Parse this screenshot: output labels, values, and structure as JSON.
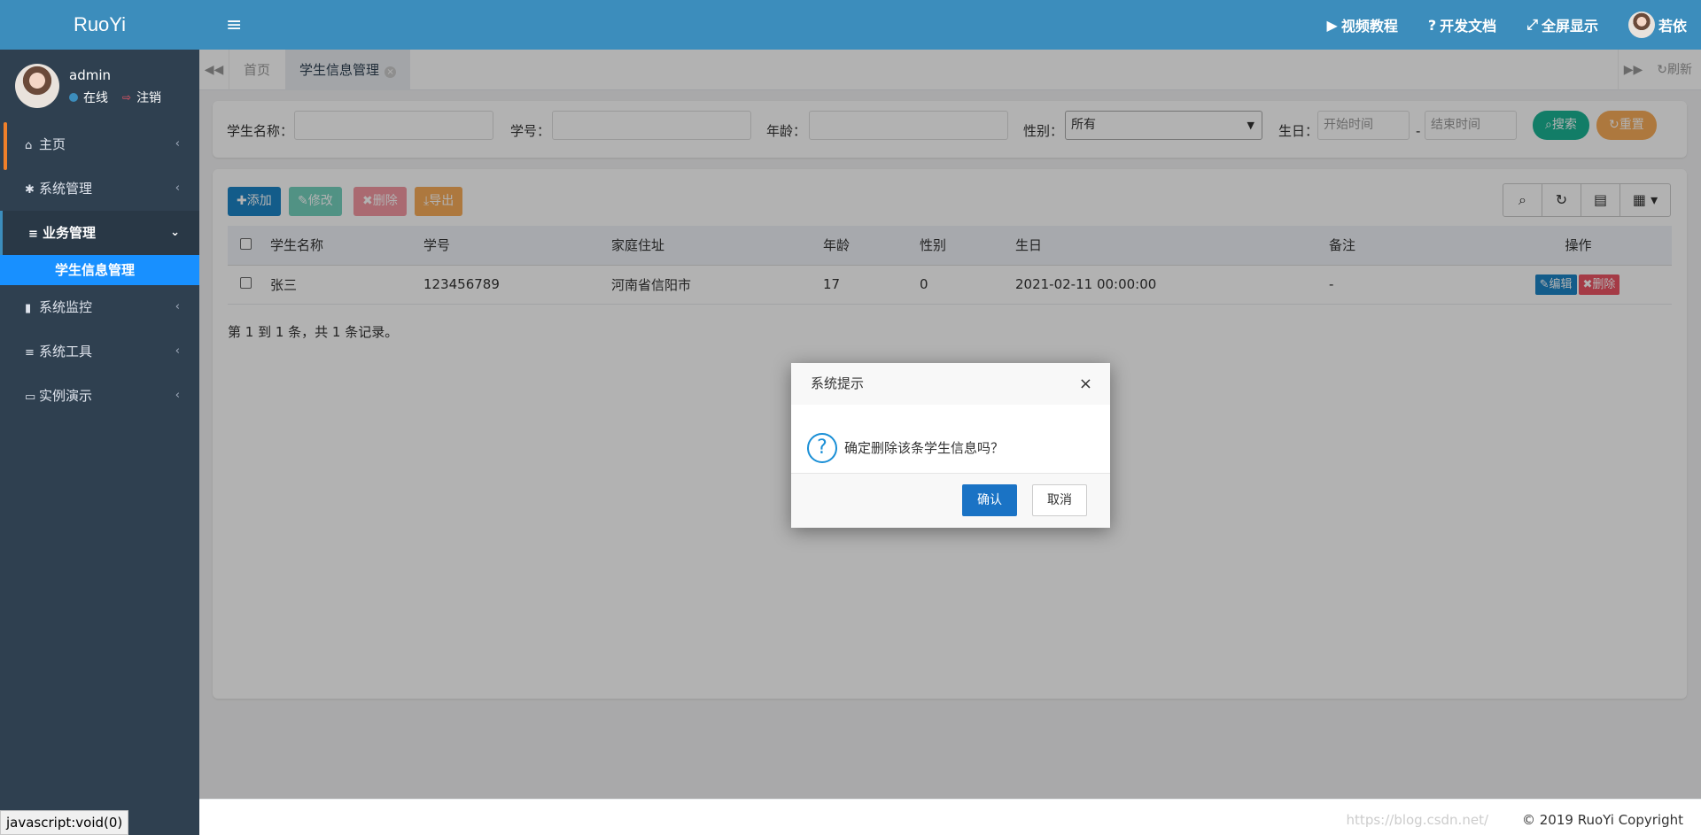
{
  "brand": "RuoYi",
  "user": {
    "name": "admin",
    "status": "在线",
    "logout": "注销"
  },
  "sidebar": {
    "items": [
      {
        "label": "主页",
        "icon": "home-icon",
        "glyph": "⌂"
      },
      {
        "label": "系统管理",
        "icon": "gear-icon",
        "glyph": "✱"
      },
      {
        "label": "业务管理",
        "icon": "bars-icon",
        "glyph": "≡",
        "active": true
      },
      {
        "label": "系统监控",
        "icon": "video-icon",
        "glyph": "▮"
      },
      {
        "label": "系统工具",
        "icon": "bars-icon",
        "glyph": "≡"
      },
      {
        "label": "实例演示",
        "icon": "desktop-icon",
        "glyph": "▭"
      }
    ],
    "sub_item": "学生信息管理"
  },
  "topbar": {
    "video": "视频教程",
    "docs": "开发文档",
    "fullscreen": "全屏显示",
    "user": "若依"
  },
  "tabs": {
    "home": "首页",
    "active": "学生信息管理",
    "refresh": "刷新"
  },
  "search": {
    "name_label": "学生名称：",
    "no_label": "学号：",
    "age_label": "年龄：",
    "gender_label": "性别：",
    "gender_value": "所有",
    "birth_label": "生日：",
    "start_placeholder": "开始时间",
    "sep": "-",
    "end_placeholder": "结束时间",
    "search_btn": "搜索",
    "reset_btn": "重置"
  },
  "toolbar": {
    "add": "添加",
    "edit": "修改",
    "delete": "删除",
    "export": "导出"
  },
  "table": {
    "headers": [
      "学生名称",
      "学号",
      "家庭住址",
      "年龄",
      "性别",
      "生日",
      "备注",
      "操作"
    ],
    "rows": [
      {
        "name": "张三",
        "no": "123456789",
        "address": "河南省信阳市",
        "age": "17",
        "gender": "0",
        "birthday": "2021-02-11 00:00:00",
        "remark": "-",
        "edit": "编辑",
        "delete": "删除"
      }
    ]
  },
  "pager": "第 1 到 1 条，共 1 条记录。",
  "footer": {
    "copyright": "© 2019 RuoYi Copyright",
    "watermark": "https://blog.csdn.net/"
  },
  "statusbar": "javascript:void(0)",
  "dialog": {
    "title": "系统提示",
    "message": "确定删除该条学生信息吗？",
    "ok": "确认",
    "cancel": "取消"
  },
  "colors": {
    "primary": "#3c8dbc",
    "sidebar": "#2f4050",
    "active_sub": "#1890ff",
    "success": "#1ab394",
    "warning": "#f8ac59",
    "danger": "#ed5565"
  }
}
